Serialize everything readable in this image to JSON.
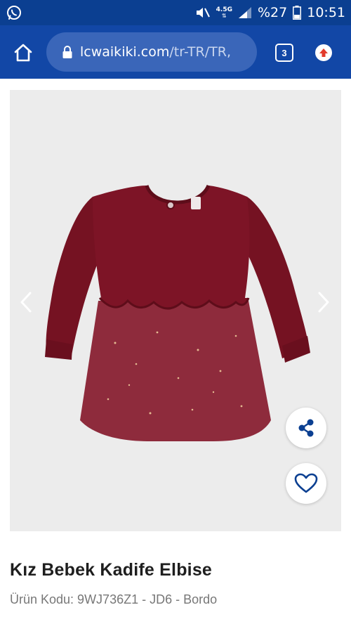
{
  "status_bar": {
    "network_label": "4.5G",
    "battery_percent": "%27",
    "time": "10:51",
    "left_icon": "whatsapp-icon",
    "icons": [
      "mute-icon",
      "signal-icon",
      "battery-icon"
    ]
  },
  "browser": {
    "url_domain": "lcwaikiki.com",
    "url_path": "/tr-TR/TR,",
    "tab_count": "3",
    "toolbar_color": "#1247a6",
    "status_color": "#0b3f91",
    "icons": [
      "home-icon",
      "lock-icon",
      "update-icon"
    ]
  },
  "product": {
    "title": "Kız Bebek Kadife Elbise",
    "code": "Ürün Kodu: 9WJ736Z1 - JD6 - Bordo",
    "image_background": "#ececec",
    "dress_color": "#7d1426",
    "gallery_icons": [
      "chevron-left-icon",
      "chevron-right-icon"
    ],
    "actions": [
      "share-icon",
      "heart-icon"
    ]
  }
}
